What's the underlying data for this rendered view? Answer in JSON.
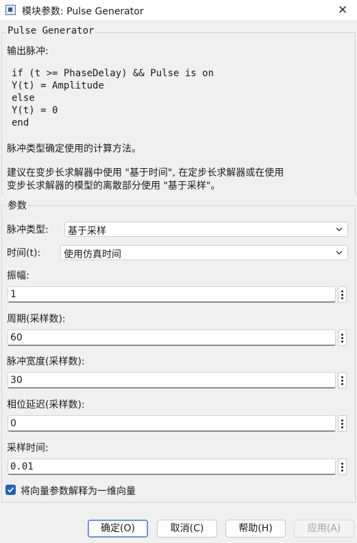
{
  "window": {
    "title": "模块参数: Pulse Generator",
    "close_glyph": "✕",
    "app_icon": "simulink-block-icon"
  },
  "description": {
    "group_title": "Pulse Generator",
    "intro": "输出脉冲:",
    "code_lines": [
      "if (t >= PhaseDelay) && Pulse is on",
      "Y(t) = Amplitude",
      "else",
      "Y(t) = 0",
      "end"
    ],
    "note1": "脉冲类型确定使用的计算方法。",
    "note2_line1": "建议在变步长求解器中使用 \"基于时间\", 在定步长求解器或在使用",
    "note2_line2": "变步长求解器的模型的离散部分使用 \"基于采样\"。"
  },
  "params": {
    "group_title": "参数",
    "pulse_type": {
      "label": "脉冲类型:",
      "value": "基于采样"
    },
    "time": {
      "label": "时间(t):",
      "value": "使用仿真时间"
    },
    "amplitude": {
      "label": "振幅:",
      "value": "1"
    },
    "period": {
      "label": "周期(采样数):",
      "value": "60"
    },
    "pulse_width": {
      "label": "脉冲宽度(采样数):",
      "value": "30"
    },
    "phase_delay": {
      "label": "相位延迟(采样数):",
      "value": "0"
    },
    "sample_time": {
      "label": "采样时间:",
      "value": "0.01"
    },
    "interpret_vector": {
      "label": "将向量参数解释为一维向量",
      "checked": true
    }
  },
  "buttons": {
    "ok": "确定(O)",
    "cancel": "取消(C)",
    "help": "帮助(H)",
    "apply": "应用(A)"
  },
  "colors": {
    "accent": "#1f62b8",
    "window_bg": "#f0f0f0"
  }
}
